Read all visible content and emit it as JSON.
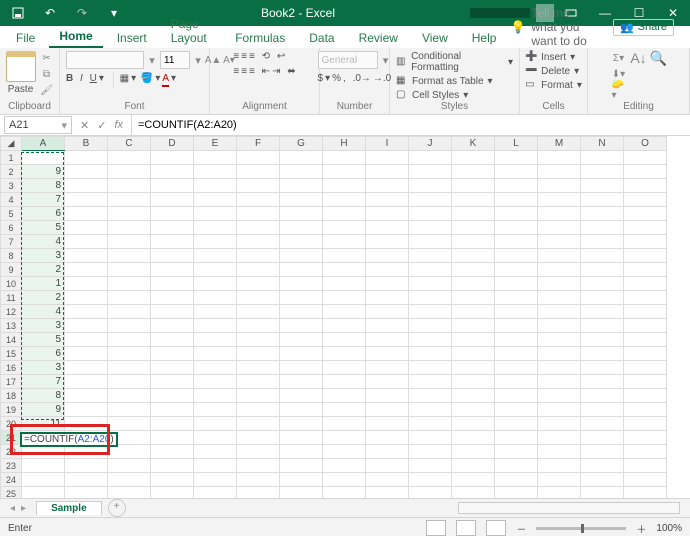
{
  "title": "Book2 - Excel",
  "tabs": [
    "File",
    "Home",
    "Insert",
    "Page Layout",
    "Formulas",
    "Data",
    "Review",
    "View",
    "Help"
  ],
  "active_tab": "Home",
  "tellme": "Tell me what you want to do",
  "share": "Share",
  "groups": {
    "clipboard": {
      "label": "Clipboard",
      "paste": "Paste"
    },
    "font": {
      "label": "Font",
      "name": "",
      "size": "11"
    },
    "alignment": {
      "label": "Alignment"
    },
    "number": {
      "label": "Number",
      "format": "General"
    },
    "styles": {
      "label": "Styles",
      "cond": "Conditional Formatting",
      "table": "Format as Table",
      "cell": "Cell Styles"
    },
    "cells": {
      "label": "Cells",
      "insert": "Insert",
      "delete": "Delete",
      "format": "Format"
    },
    "editing": {
      "label": "Editing"
    }
  },
  "namebox": "A21",
  "formula_bar": "=COUNTIF(A2:A20)",
  "cell_formula_prefix": "=COUNTIF(",
  "cell_formula_range": "A2:A20",
  "cell_formula_suffix": ")",
  "columns": [
    "A",
    "B",
    "C",
    "D",
    "E",
    "F",
    "G",
    "H",
    "I",
    "J",
    "K",
    "L",
    "M",
    "N",
    "O"
  ],
  "rows": [
    {
      "n": 1,
      "a": ""
    },
    {
      "n": 2,
      "a": "9"
    },
    {
      "n": 3,
      "a": "8"
    },
    {
      "n": 4,
      "a": "7"
    },
    {
      "n": 5,
      "a": "6"
    },
    {
      "n": 6,
      "a": "5"
    },
    {
      "n": 7,
      "a": "4"
    },
    {
      "n": 8,
      "a": "3"
    },
    {
      "n": 9,
      "a": "2"
    },
    {
      "n": 10,
      "a": "1"
    },
    {
      "n": 11,
      "a": "2"
    },
    {
      "n": 12,
      "a": "4"
    },
    {
      "n": 13,
      "a": "3"
    },
    {
      "n": 14,
      "a": "5"
    },
    {
      "n": 15,
      "a": "6"
    },
    {
      "n": 16,
      "a": "3"
    },
    {
      "n": 17,
      "a": "7"
    },
    {
      "n": 18,
      "a": "8"
    },
    {
      "n": 19,
      "a": "9"
    },
    {
      "n": 20,
      "a": "11"
    },
    {
      "n": 21,
      "a": ""
    },
    {
      "n": 22,
      "a": ""
    },
    {
      "n": 23,
      "a": ""
    },
    {
      "n": 24,
      "a": ""
    },
    {
      "n": 25,
      "a": ""
    }
  ],
  "sheet_tab": "Sample",
  "status_left": "Enter",
  "zoom": "100%"
}
